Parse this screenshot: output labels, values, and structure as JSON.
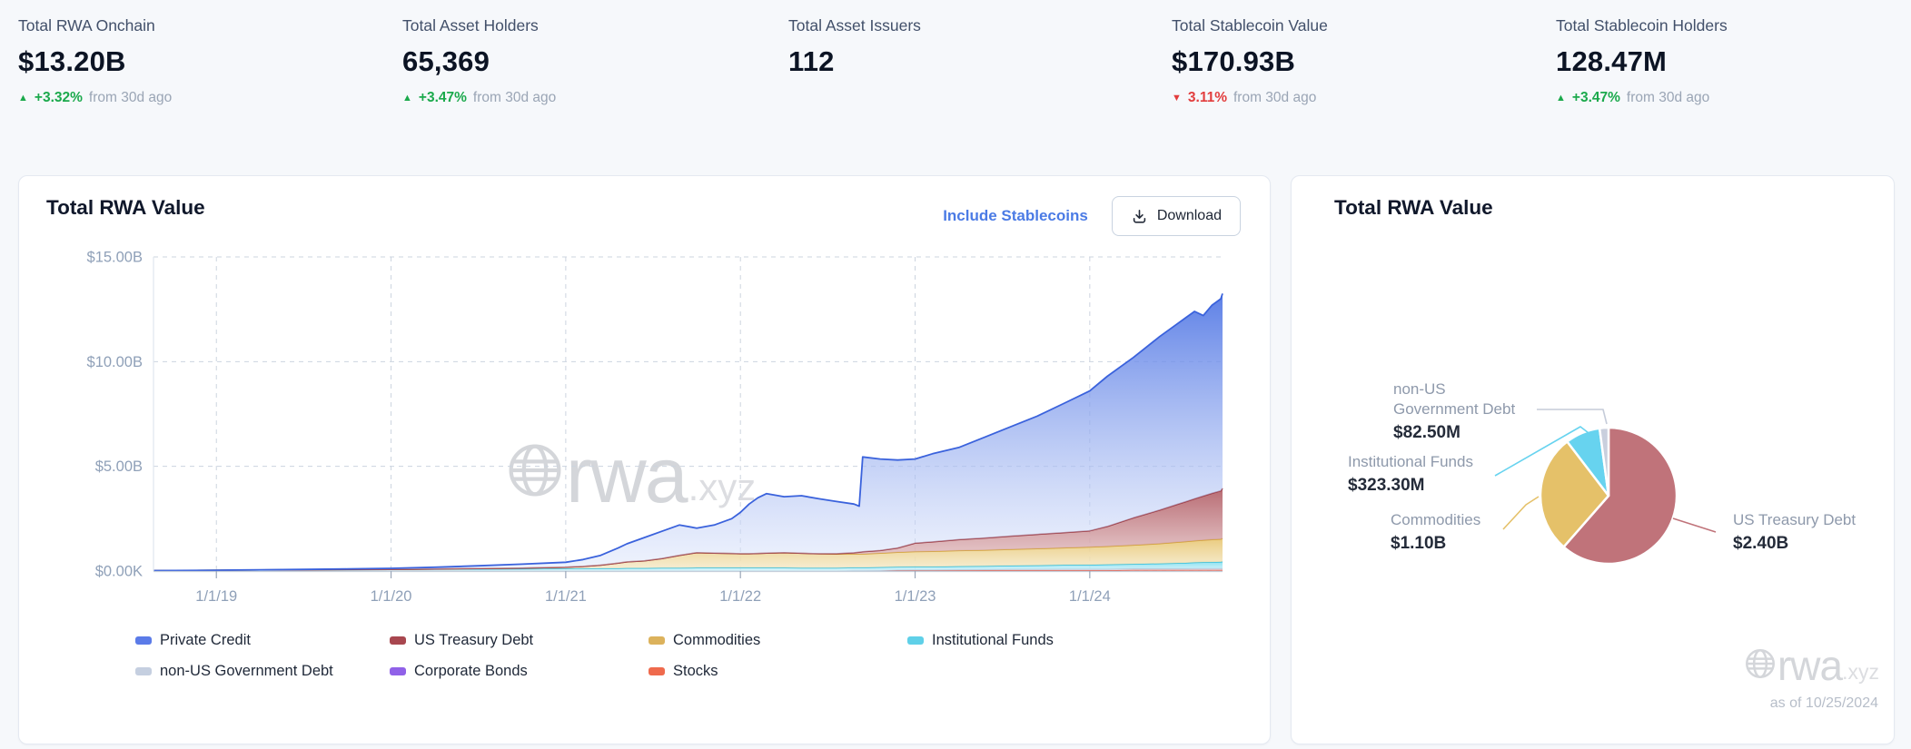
{
  "stats": [
    {
      "label": "Total RWA Onchain",
      "value": "$13.20B",
      "delta_dir": "up",
      "delta": "+3.32%",
      "delta_suffix": "from 30d ago"
    },
    {
      "label": "Total Asset Holders",
      "value": "65,369",
      "delta_dir": "up",
      "delta": "+3.47%",
      "delta_suffix": "from 30d ago"
    },
    {
      "label": "Total Asset Issuers",
      "value": "112"
    },
    {
      "label": "Total Stablecoin Value",
      "value": "$170.93B",
      "delta_dir": "down",
      "delta": "3.11%",
      "delta_suffix": "from 30d ago"
    },
    {
      "label": "Total Stablecoin Holders",
      "value": "128.47M",
      "delta_dir": "up",
      "delta": "+3.47%",
      "delta_suffix": "from 30d ago"
    }
  ],
  "left_card": {
    "title": "Total RWA Value",
    "include_link": "Include Stablecoins",
    "download_label": "Download",
    "watermark_brand": "rwa",
    "watermark_tld": ".xyz"
  },
  "right_card": {
    "title": "Total RWA Value",
    "as_of": "as of 10/25/2024",
    "watermark_brand": "rwa",
    "watermark_tld": ".xyz"
  },
  "legend": [
    {
      "label": "Private Credit",
      "color": "#5b7be8"
    },
    {
      "label": "US Treasury Debt",
      "color": "#a8474f"
    },
    {
      "label": "Commodities",
      "color": "#dcb25c"
    },
    {
      "label": "Institutional Funds",
      "color": "#5fd0e8"
    },
    {
      "label": "non-US Government Debt",
      "color": "#c5cfe0"
    },
    {
      "label": "Corporate Bonds",
      "color": "#9061e8"
    },
    {
      "label": "Stocks",
      "color": "#ef6a4d"
    }
  ],
  "chart_data": [
    {
      "type": "area",
      "stacked": true,
      "title": "Total RWA Value",
      "unit": "USD billions",
      "grid": true,
      "legend_position": "bottom",
      "x_domain": [
        2018.64,
        2024.76
      ],
      "ylim": [
        0,
        15
      ],
      "y_ticks": [
        {
          "v": 15,
          "label": "$15.00B"
        },
        {
          "v": 10,
          "label": "$10.00B"
        },
        {
          "v": 5,
          "label": "$5.00B"
        },
        {
          "v": 0,
          "label": "$0.00K"
        }
      ],
      "x_ticks": [
        {
          "v": 2019,
          "label": "1/1/19"
        },
        {
          "v": 2020,
          "label": "1/1/20"
        },
        {
          "v": 2021,
          "label": "1/1/21"
        },
        {
          "v": 2022,
          "label": "1/1/22"
        },
        {
          "v": 2023,
          "label": "1/1/23"
        },
        {
          "v": 2024,
          "label": "1/1/24"
        }
      ],
      "x": [
        2018.64,
        2019.0,
        2019.25,
        2019.5,
        2019.75,
        2020.0,
        2020.25,
        2020.5,
        2020.75,
        2021.0,
        2021.1,
        2021.2,
        2021.3,
        2021.35,
        2021.45,
        2021.55,
        2021.65,
        2021.75,
        2021.85,
        2021.95,
        2022.0,
        2022.05,
        2022.1,
        2022.15,
        2022.25,
        2022.35,
        2022.45,
        2022.55,
        2022.65,
        2022.68,
        2022.7,
        2022.8,
        2022.9,
        2023.0,
        2023.1,
        2023.25,
        2023.4,
        2023.55,
        2023.7,
        2023.85,
        2024.0,
        2024.1,
        2024.25,
        2024.4,
        2024.5,
        2024.55,
        2024.6,
        2024.65,
        2024.7,
        2024.75,
        2024.76
      ],
      "series": [
        {
          "name": "Stocks",
          "stroke": "#dd4f3e",
          "fill": [
            "#f2988a",
            "#f8cfc7"
          ],
          "fill_opacity": [
            0.9,
            0.7
          ],
          "values": [
            0,
            0,
            0,
            0,
            0,
            0,
            0,
            0,
            0,
            0,
            0,
            0,
            0,
            0,
            0,
            0,
            0,
            0,
            0,
            0,
            0,
            0,
            0,
            0,
            0,
            0,
            0,
            0,
            0.02,
            0.02,
            0.02,
            0.03,
            0.03,
            0.03,
            0.03,
            0.03,
            0.04,
            0.04,
            0.04,
            0.04,
            0.04,
            0.04,
            0.05,
            0.05,
            0.05,
            0.05,
            0.05,
            0.05,
            0.05,
            0.05,
            0.05
          ]
        },
        {
          "name": "Corporate Bonds",
          "stroke": "#9061e8",
          "values_constant": 0
        },
        {
          "name": "non-US Government Debt",
          "stroke": "#b8c3d6",
          "fill": [
            "#dde4f0",
            "#eef2f8"
          ],
          "fill_opacity": [
            0.95,
            0.85
          ],
          "values": [
            0,
            0,
            0,
            0,
            0,
            0,
            0,
            0,
            0,
            0,
            0,
            0,
            0,
            0,
            0,
            0,
            0,
            0,
            0,
            0,
            0,
            0,
            0,
            0,
            0,
            0,
            0,
            0,
            0,
            0,
            0,
            0,
            0.02,
            0.03,
            0.03,
            0.04,
            0.04,
            0.05,
            0.05,
            0.06,
            0.06,
            0.06,
            0.07,
            0.07,
            0.07,
            0.07,
            0.08,
            0.08,
            0.08,
            0.08,
            0.08
          ]
        },
        {
          "name": "Institutional Funds",
          "stroke": "#33bedb",
          "fill": [
            "#86dff0",
            "#d2f3fa"
          ],
          "fill_opacity": [
            0.95,
            0.8
          ],
          "values": [
            0.02,
            0.04,
            0.05,
            0.06,
            0.07,
            0.08,
            0.09,
            0.1,
            0.11,
            0.12,
            0.12,
            0.13,
            0.13,
            0.14,
            0.14,
            0.15,
            0.15,
            0.16,
            0.16,
            0.16,
            0.16,
            0.16,
            0.16,
            0.16,
            0.16,
            0.15,
            0.15,
            0.15,
            0.15,
            0.15,
            0.15,
            0.15,
            0.15,
            0.15,
            0.15,
            0.16,
            0.16,
            0.17,
            0.18,
            0.19,
            0.2,
            0.21,
            0.22,
            0.24,
            0.26,
            0.27,
            0.28,
            0.29,
            0.3,
            0.31,
            0.32
          ]
        },
        {
          "name": "Commodities",
          "stroke": "#d2a035",
          "fill": [
            "#e9c979",
            "#f6ecd0"
          ],
          "fill_opacity": [
            0.95,
            0.85
          ],
          "values": [
            0,
            0,
            0,
            0,
            0,
            0,
            0.01,
            0.02,
            0.03,
            0.06,
            0.1,
            0.15,
            0.25,
            0.3,
            0.35,
            0.45,
            0.6,
            0.72,
            0.7,
            0.68,
            0.67,
            0.67,
            0.68,
            0.7,
            0.72,
            0.7,
            0.68,
            0.66,
            0.65,
            0.65,
            0.65,
            0.68,
            0.7,
            0.72,
            0.73,
            0.75,
            0.76,
            0.78,
            0.8,
            0.82,
            0.85,
            0.87,
            0.9,
            0.95,
            1.0,
            1.02,
            1.04,
            1.06,
            1.08,
            1.09,
            1.1
          ]
        },
        {
          "name": "US Treasury Debt",
          "stroke": "#9c3a42",
          "fill": [
            "#b25f67",
            "#ecd3d5"
          ],
          "fill_opacity": [
            0.92,
            0.85
          ],
          "values": [
            0,
            0,
            0,
            0,
            0,
            0,
            0,
            0,
            0,
            0,
            0,
            0,
            0,
            0,
            0,
            0,
            0,
            0,
            0,
            0,
            0,
            0,
            0,
            0,
            0,
            0,
            0,
            0.02,
            0.05,
            0.08,
            0.1,
            0.12,
            0.2,
            0.4,
            0.45,
            0.52,
            0.58,
            0.63,
            0.68,
            0.72,
            0.77,
            0.95,
            1.3,
            1.6,
            1.8,
            1.9,
            2.0,
            2.1,
            2.2,
            2.3,
            2.4
          ]
        },
        {
          "name": "Private Credit",
          "stroke": "#3a62dc",
          "fill": [
            "#4f75e4",
            "#dfe7fb"
          ],
          "fill_opacity": [
            0.92,
            0.5
          ],
          "values": [
            0.0,
            0.0,
            0.01,
            0.02,
            0.03,
            0.05,
            0.08,
            0.13,
            0.19,
            0.24,
            0.33,
            0.47,
            0.72,
            0.86,
            1.11,
            1.3,
            1.45,
            1.17,
            1.34,
            1.66,
            1.97,
            2.37,
            2.66,
            2.84,
            2.67,
            2.75,
            2.62,
            2.49,
            2.33,
            2.2,
            4.53,
            4.37,
            4.2,
            4.02,
            4.21,
            4.4,
            4.82,
            5.23,
            5.65,
            6.17,
            6.68,
            7.17,
            7.66,
            8.29,
            8.62,
            8.79,
            8.95,
            8.62,
            8.99,
            9.17,
            9.3
          ]
        }
      ]
    },
    {
      "type": "pie",
      "title": "Total RWA Value",
      "as_of": "as of 10/25/2024",
      "direction": "clockwise",
      "start_angle_deg": 0,
      "slices": [
        {
          "label": "US Treasury Debt",
          "value_label": "$2.40B",
          "value_busd": 2.4,
          "color": "#c0737a"
        },
        {
          "label": "Commodities",
          "value_label": "$1.10B",
          "value_busd": 1.1,
          "color": "#e5c169"
        },
        {
          "label": "Institutional Funds",
          "value_label": "$323.30M",
          "value_busd": 0.3233,
          "color": "#67d3ef"
        },
        {
          "label": "non-US Government Debt",
          "value_label": "$82.50M",
          "value_busd": 0.0825,
          "color": "#c9cfdd"
        }
      ]
    }
  ]
}
